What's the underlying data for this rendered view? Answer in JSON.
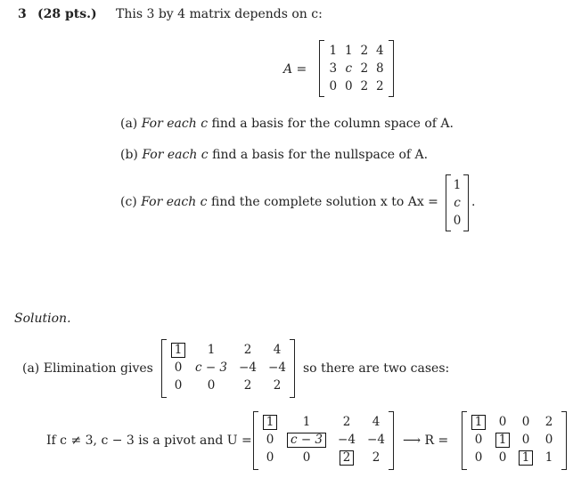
{
  "problem": {
    "number": "3",
    "points": "(28 pts.)",
    "intro": "This 3 by 4 matrix depends on c:",
    "matrix_label": "A =",
    "matrix_A": [
      [
        "1",
        "1",
        "2",
        "4"
      ],
      [
        "3",
        "c",
        "2",
        "8"
      ],
      [
        "0",
        "0",
        "2",
        "2"
      ]
    ],
    "parts": [
      {
        "label": "(a)",
        "italic": "For each c",
        "text": "find a basis for the column space of A."
      },
      {
        "label": "(b)",
        "italic": "For each c",
        "text": "find a basis for the nullspace of A."
      },
      {
        "label": "(c)",
        "italic": "For each c",
        "text": "find the complete solution x to Ax ="
      }
    ],
    "rhs_vector": [
      "1",
      "c",
      "0"
    ],
    "rhs_end": "."
  },
  "solution": {
    "heading": "Solution.",
    "part_a_label": "(a)",
    "part_a_text": "Elimination gives",
    "elim_matrix": [
      [
        "1",
        "1",
        "2",
        "4"
      ],
      [
        "0",
        "c − 3",
        "−4",
        "−4"
      ],
      [
        "0",
        "0",
        "2",
        "2"
      ]
    ],
    "part_a_after": "so there are two cases:",
    "case_text": "If c ≠ 3, c − 3 is a pivot and U =",
    "U_matrix": [
      [
        "1",
        "1",
        "2",
        "4"
      ],
      [
        "0",
        "c − 3",
        "−4",
        "−4"
      ],
      [
        "0",
        "0",
        "2",
        "2"
      ]
    ],
    "arrow_text": "⟶ R =",
    "R_matrix": [
      [
        "1",
        "0",
        "0",
        "2"
      ],
      [
        "0",
        "1",
        "0",
        "0"
      ],
      [
        "0",
        "0",
        "1",
        "1"
      ]
    ]
  }
}
